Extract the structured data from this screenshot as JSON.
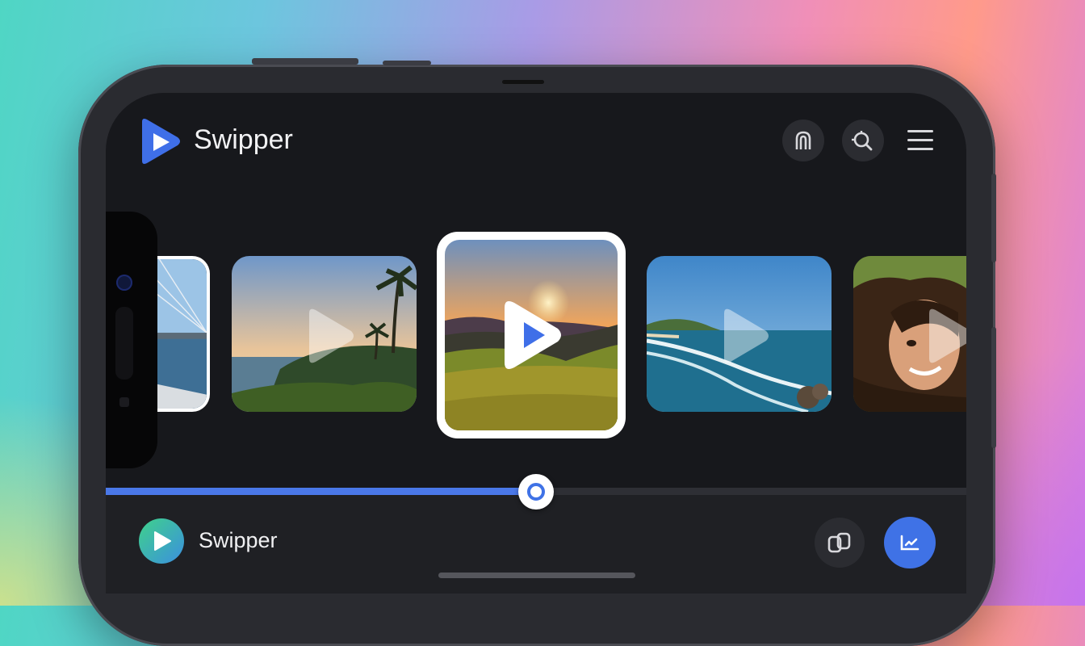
{
  "app": {
    "title": "Swipper",
    "header_icons": [
      "arch-icon",
      "search-icon",
      "menu-icon"
    ]
  },
  "carousel": {
    "items": [
      {
        "scene": "bridge",
        "selected": false
      },
      {
        "scene": "tropical-palms-sunset",
        "selected": false
      },
      {
        "scene": "sunset-meadow",
        "selected": true
      },
      {
        "scene": "ocean-coast",
        "selected": false
      },
      {
        "scene": "smiling-woman-portrait",
        "selected": false
      }
    ]
  },
  "player": {
    "progress": 0.5
  },
  "bottom_bar": {
    "title": "Swipper",
    "icons": [
      "layers-icon",
      "activity-icon"
    ]
  },
  "colors": {
    "accent": "#4a78e8",
    "screen_bg": "#17181c",
    "bottom_bar_bg": "#1f2024"
  }
}
